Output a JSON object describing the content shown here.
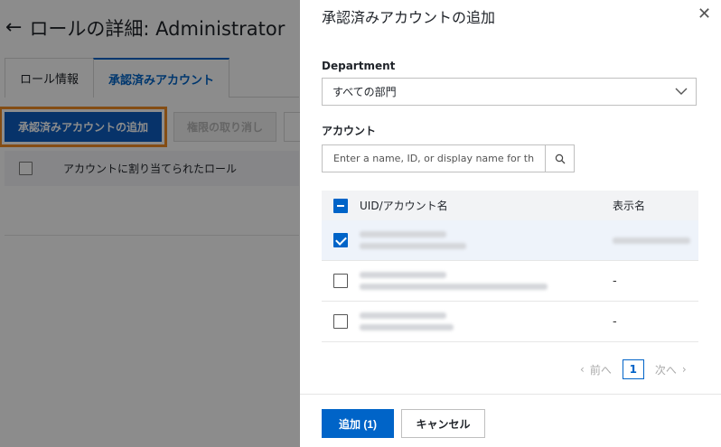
{
  "background": {
    "back_icon": "arrow-left-icon",
    "title": "ロールの詳細: Administrator",
    "tabs": [
      {
        "label": "ロール情報",
        "active": false
      },
      {
        "label": "承認済みアカウント",
        "active": true
      }
    ],
    "toolbar": {
      "add_label": "承認済みアカウントの追加",
      "revoke_label": "権限の取り消し"
    },
    "table_header": "アカウントに割り当てられたロール"
  },
  "drawer": {
    "title": "承認済みアカウントの追加",
    "close_icon": "close-icon",
    "department": {
      "label": "Department",
      "value": "すべての部門"
    },
    "account": {
      "label": "アカウント",
      "placeholder": "Enter a name, ID, or display name for the ac"
    },
    "table": {
      "columns": [
        "UID/アカウント名",
        "表示名"
      ],
      "rows": [
        {
          "checked": true,
          "display_name": ""
        },
        {
          "checked": false,
          "display_name": "-"
        },
        {
          "checked": false,
          "display_name": "-"
        }
      ]
    },
    "pagination": {
      "prev": "前へ",
      "current": "1",
      "next": "次へ"
    },
    "footer": {
      "add_label": "追加 (1)",
      "cancel_label": "キャンセル"
    }
  },
  "colors": {
    "primary": "#0064c8",
    "highlight": "#f08c26"
  }
}
